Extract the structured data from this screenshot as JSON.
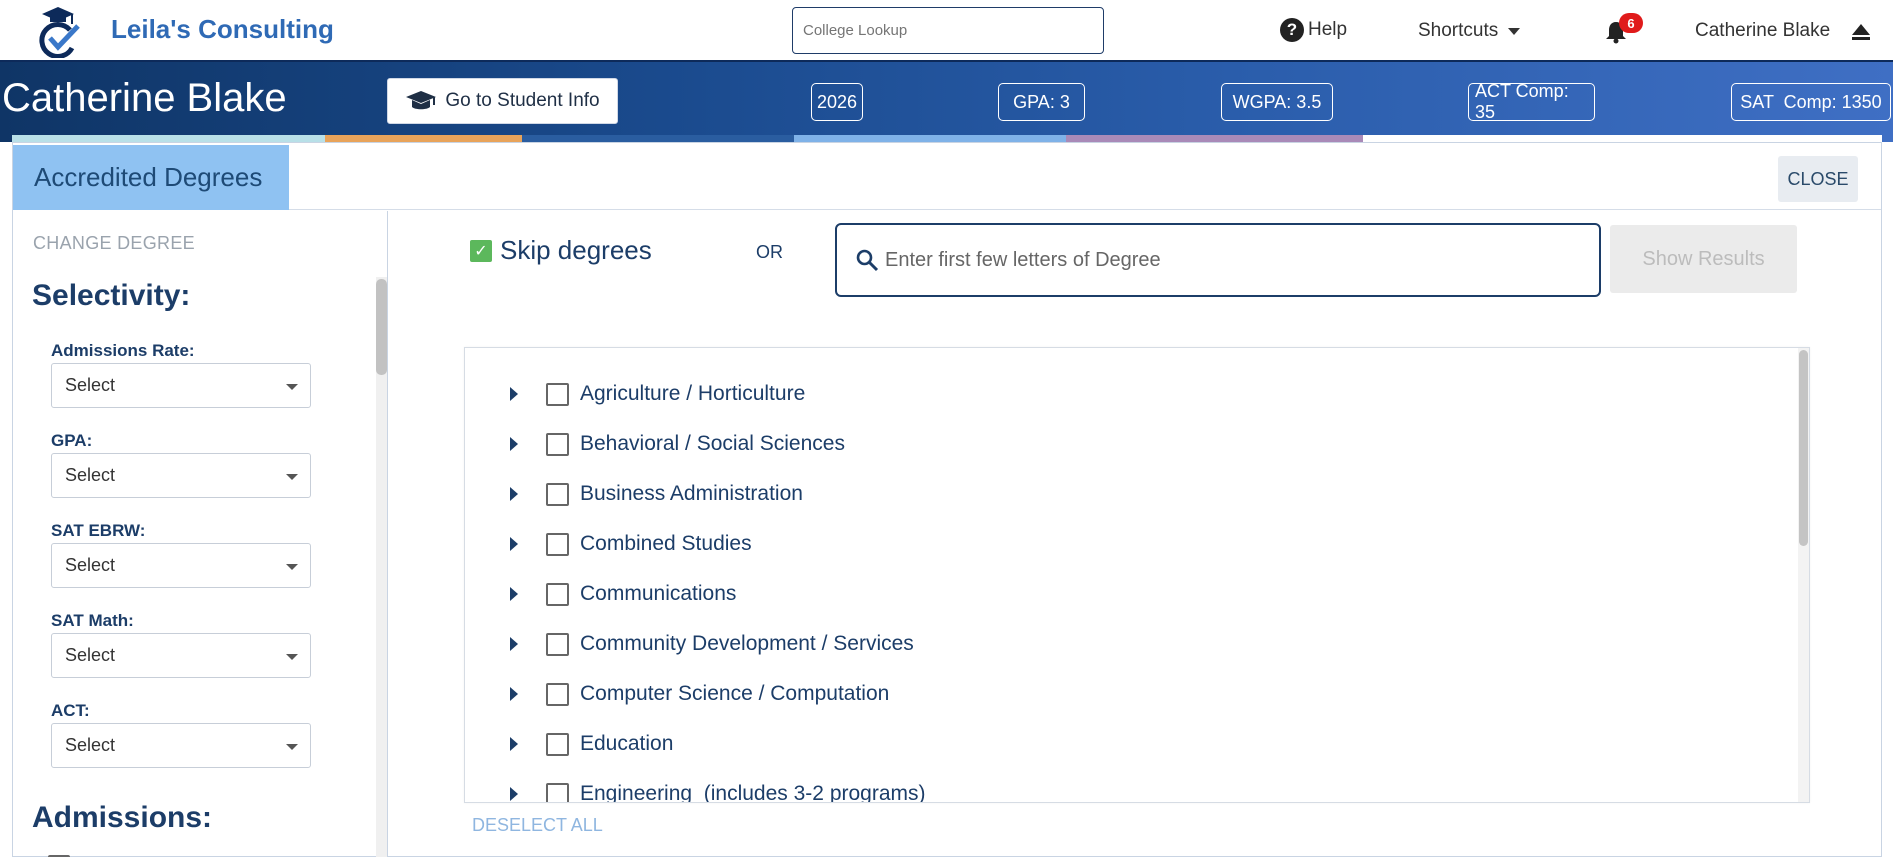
{
  "topbar": {
    "brand": "Leila's Consulting",
    "college_lookup_placeholder": "College Lookup",
    "help_label": "Help",
    "shortcuts_label": "Shortcuts",
    "notification_count": "6",
    "user_name": "Catherine Blake"
  },
  "student": {
    "name": "Catherine Blake",
    "student_info_button": "Go to Student Info",
    "stats": [
      "2026",
      "GPA: 3",
      "WGPA: 3.5",
      "ACT Comp: 35",
      "SAT  Comp: 1350"
    ]
  },
  "colors": {
    "brand": "#2f6ab5",
    "navy": "#1c3d68",
    "strip": [
      "#b8e0e8",
      "#e8a35a",
      "#2a5da0",
      "#7fb2e8",
      "#a98ab8",
      "#ffffff"
    ]
  },
  "panel": {
    "title": "Accredited Degrees",
    "close_label": "CLOSE"
  },
  "sidebar": {
    "change_degree": "CHANGE DEGREE",
    "selectivity_title": "Selectivity:",
    "filters": [
      {
        "label": "Admissions Rate:",
        "value": "Select"
      },
      {
        "label": "GPA:",
        "value": "Select"
      },
      {
        "label": "SAT EBRW:",
        "value": "Select"
      },
      {
        "label": "SAT Math:",
        "value": "Select"
      },
      {
        "label": "ACT:",
        "value": "Select"
      }
    ],
    "admissions_title": "Admissions:"
  },
  "main": {
    "skip_label": "Skip degrees",
    "skip_checked": true,
    "or_label": "OR",
    "search_placeholder": "Enter first few letters of Degree",
    "show_results": "Show Results",
    "degrees": [
      "Agriculture / Horticulture",
      "Behavioral / Social Sciences",
      "Business Administration",
      "Combined Studies",
      "Communications",
      "Community Development / Services",
      "Computer Science / Computation",
      "Education",
      "Engineering  (includes 3-2 programs)"
    ],
    "deselect_all": "DESELECT ALL"
  }
}
